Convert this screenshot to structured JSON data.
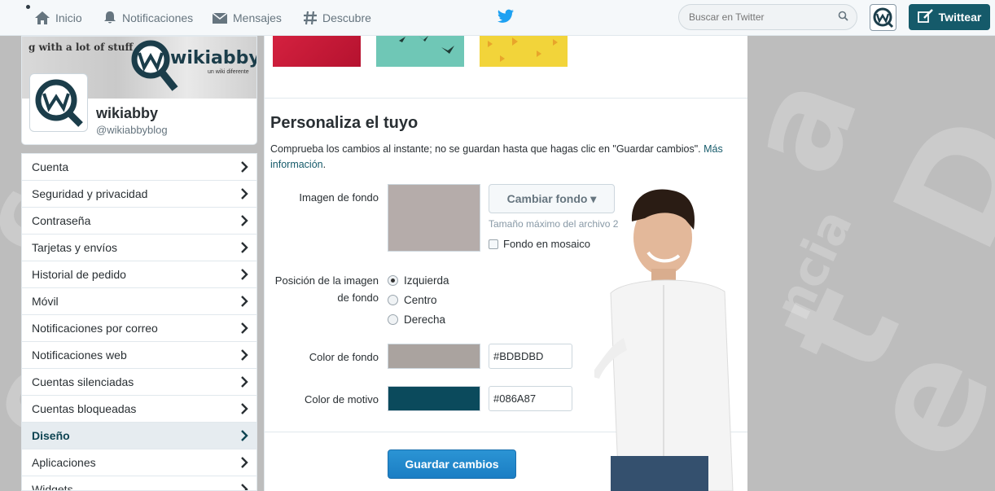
{
  "colors": {
    "accent": "#086A87",
    "brand_button": "#155a6a",
    "save_button": "#1b7ec4",
    "page_background": "#BDBDBD"
  },
  "topbar": {
    "nav": [
      {
        "label": "Inicio",
        "icon": "home-icon"
      },
      {
        "label": "Notificaciones",
        "icon": "bell-icon"
      },
      {
        "label": "Mensajes",
        "icon": "envelope-icon"
      },
      {
        "label": "Descubre",
        "icon": "hashtag-icon"
      }
    ],
    "logo_icon": "twitter-bird-icon",
    "search_placeholder": "Buscar en Twitter",
    "tweet_button": "Twittear"
  },
  "profile": {
    "banner_text": "g with a lot of stuff",
    "banner_logo_word": "wikiabby",
    "banner_sub": "un wiki diferente",
    "name": "wikiabby",
    "handle": "@wikiabbyblog"
  },
  "sidebar": {
    "items": [
      {
        "label": "Cuenta"
      },
      {
        "label": "Seguridad y privacidad"
      },
      {
        "label": "Contraseña"
      },
      {
        "label": "Tarjetas y envíos"
      },
      {
        "label": "Historial de pedido"
      },
      {
        "label": "Móvil"
      },
      {
        "label": "Notificaciones por correo"
      },
      {
        "label": "Notificaciones web"
      },
      {
        "label": "Cuentas silenciadas"
      },
      {
        "label": "Cuentas bloqueadas"
      },
      {
        "label": "Diseño",
        "active": true
      },
      {
        "label": "Aplicaciones"
      },
      {
        "label": "Widgets"
      }
    ]
  },
  "themes": [
    {
      "color": "#c8173a"
    },
    {
      "color": "#6fc7b6"
    },
    {
      "color": "#f2d43a"
    }
  ],
  "main": {
    "title": "Personaliza el tuyo",
    "description": "Comprueba los cambios al instante; no se guardan hasta que hagas clic en \"Guardar cambios\".",
    "more_info_link": "Más información",
    "background_image_label": "Imagen de fondo",
    "change_background_button": "Cambiar fondo ▾",
    "max_file_size": "Tamaño máximo del archivo 2",
    "tile_background_label": "Fondo en mosaico",
    "position_label": "Posición de la imagen de fondo",
    "position_options": [
      {
        "label": "Izquierda",
        "checked": true
      },
      {
        "label": "Centro",
        "checked": false
      },
      {
        "label": "Derecha",
        "checked": false
      }
    ],
    "background_color_label": "Color de fondo",
    "background_color_value": "#BDBDBD",
    "theme_color_label": "Color de motivo",
    "theme_color_value": "#086A87",
    "save_button": "Guardar cambios"
  }
}
